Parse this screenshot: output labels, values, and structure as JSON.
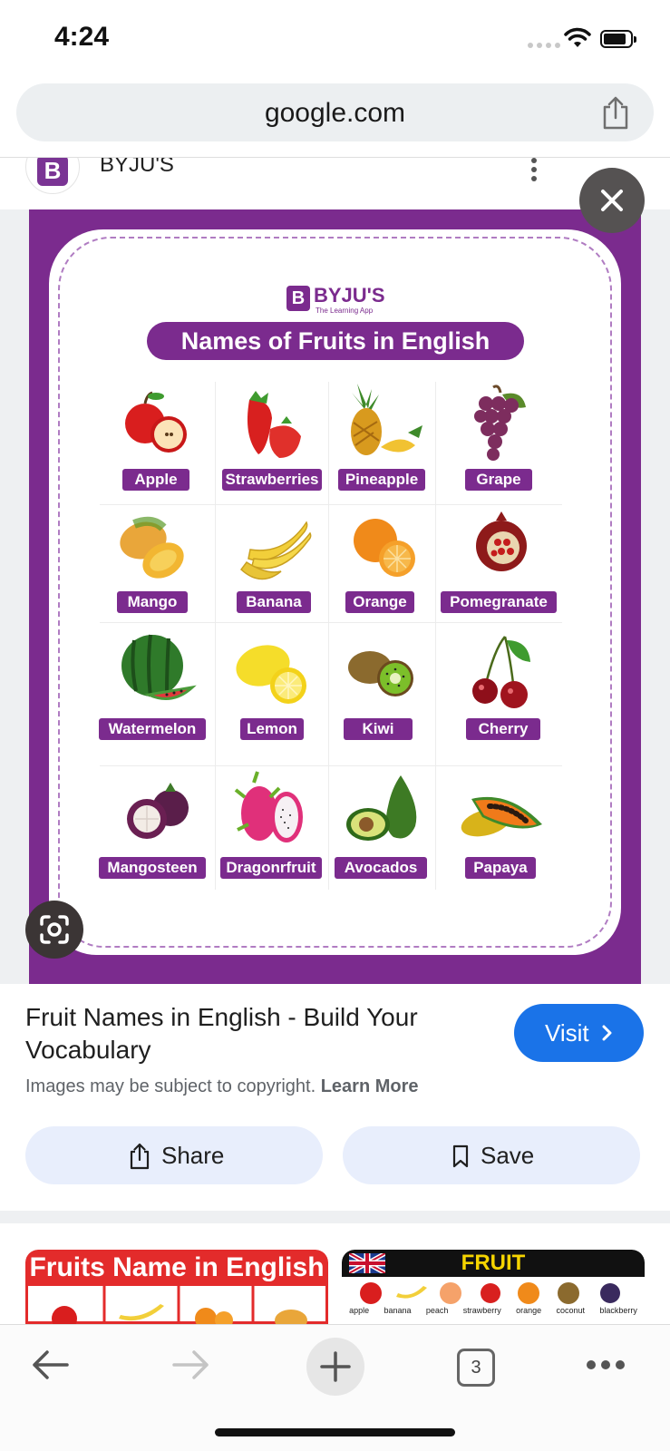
{
  "status_bar": {
    "time": "4:24"
  },
  "url_bar": {
    "url": "google.com"
  },
  "source": {
    "name": "BYJU'S",
    "logo_letter": "B"
  },
  "poster": {
    "brand": "BYJU'S",
    "brand_tagline": "The Learning App",
    "brand_mark": "B",
    "title": "Names of Fruits in English",
    "fruits": [
      "Apple",
      "Strawberries",
      "Pineapple",
      "Grape",
      "Mango",
      "Banana",
      "Orange",
      "Pomegranate",
      "Watermelon",
      "Lemon",
      "Kiwi",
      "Cherry",
      "Mangosteen",
      "Dragonrfruit",
      "Avocados",
      "Papaya"
    ]
  },
  "result": {
    "title": "Fruit Names in English - Build Your Vocabulary",
    "visit_label": "Visit",
    "copyright_text": "Images may be subject to copyright.",
    "learn_more": "Learn More",
    "share_label": "Share",
    "save_label": "Save"
  },
  "related": {
    "thumb1_title": "Fruits Name in English",
    "thumb2_title": "FRUIT",
    "thumb2_labels": [
      "apple",
      "banana",
      "peach",
      "strawberry",
      "orange",
      "coconut",
      "blackberry"
    ]
  },
  "toolbar": {
    "tab_count": "3"
  },
  "colors": {
    "poster_purple": "#7b2b8e",
    "visit_blue": "#1a73e8",
    "pill_bg": "#e8eefc"
  }
}
